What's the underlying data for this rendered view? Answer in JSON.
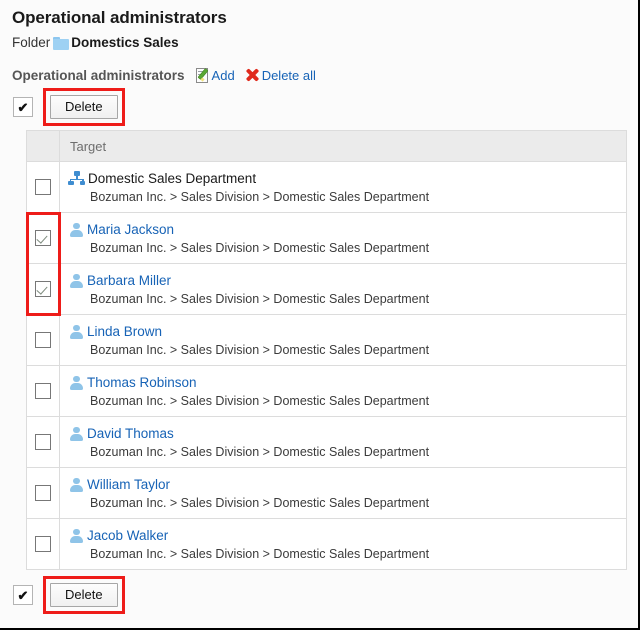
{
  "page": {
    "title": "Operational administrators",
    "folder_label": "Folder",
    "folder_name": "Domestics Sales",
    "folder_icon": "folder-icon"
  },
  "section": {
    "title": "Operational administrators",
    "add_label": "Add",
    "add_icon": "add-document-pencil-icon",
    "delete_all_label": "Delete all",
    "delete_all_icon": "red-x-icon"
  },
  "toolbar_top": {
    "select_all_check": "✔",
    "delete_label": "Delete"
  },
  "toolbar_bottom": {
    "select_all_check": "✔",
    "delete_label": "Delete"
  },
  "table": {
    "header": {
      "checkbox_col": "",
      "target_col": "Target"
    },
    "rows": [
      {
        "checked": false,
        "type": "department",
        "icon": "department-org-chart-icon",
        "name": "Domestic Sales Department",
        "is_link": false,
        "path": "Bozuman Inc. > Sales Division > Domestic Sales Department"
      },
      {
        "checked": true,
        "type": "user",
        "icon": "person-icon",
        "name": "Maria Jackson",
        "is_link": true,
        "path": "Bozuman Inc. > Sales Division > Domestic Sales Department"
      },
      {
        "checked": true,
        "type": "user",
        "icon": "person-icon",
        "name": "Barbara Miller",
        "is_link": true,
        "path": "Bozuman Inc. > Sales Division > Domestic Sales Department"
      },
      {
        "checked": false,
        "type": "user",
        "icon": "person-icon",
        "name": "Linda Brown",
        "is_link": true,
        "path": "Bozuman Inc. > Sales Division > Domestic Sales Department"
      },
      {
        "checked": false,
        "type": "user",
        "icon": "person-icon",
        "name": "Thomas Robinson",
        "is_link": true,
        "path": "Bozuman Inc. > Sales Division > Domestic Sales Department"
      },
      {
        "checked": false,
        "type": "user",
        "icon": "person-icon",
        "name": "David Thomas",
        "is_link": true,
        "path": "Bozuman Inc. > Sales Division > Domestic Sales Department"
      },
      {
        "checked": false,
        "type": "user",
        "icon": "person-icon",
        "name": "William Taylor",
        "is_link": true,
        "path": "Bozuman Inc. > Sales Division > Domestic Sales Department"
      },
      {
        "checked": false,
        "type": "user",
        "icon": "person-icon",
        "name": "Jacob Walker",
        "is_link": true,
        "path": "Bozuman Inc. > Sales Division > Domestic Sales Department"
      }
    ]
  },
  "colors": {
    "link": "#1763b6",
    "highlight": "#ee1c19",
    "header_bg": "#ebebeb",
    "icon_blue": "#8fc4e8",
    "dept_blue": "#3f8dd0",
    "delete_x": "#e02a1c",
    "pencil_green": "#5aa832"
  }
}
